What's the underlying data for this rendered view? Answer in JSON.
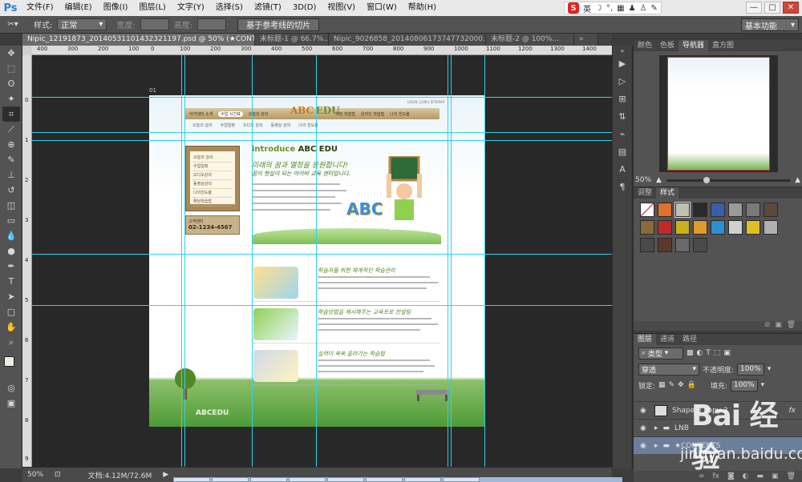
{
  "menu": {
    "logo": "Ps",
    "items": [
      "文件(F)",
      "编辑(E)",
      "图像(I)",
      "图层(L)",
      "文字(Y)",
      "选择(S)",
      "滤镜(T)",
      "3D(D)",
      "视图(V)",
      "窗口(W)",
      "帮助(H)"
    ],
    "ime_brand": "S",
    "ime_lang": "英",
    "window_controls": [
      "—",
      "□",
      "✕"
    ]
  },
  "options": {
    "style_label": "样式:",
    "style_value": "正常",
    "width_label": "宽度:",
    "height_label": "高度:",
    "slice_button": "基于参考线的切片",
    "workspace": "基本功能"
  },
  "tabs": [
    {
      "label": "Nipic_12191873_20140531101432321197.psd @ 50% (★CONTENTS, RGB/8) *",
      "active": true
    },
    {
      "label": "未标题-1 @ 66.7%...",
      "active": false
    },
    {
      "label": "Nipic_9026858_20140806173747732000.psd",
      "active": false
    },
    {
      "label": "未标题-2 @ 100%...",
      "active": false
    }
  ],
  "rulers": {
    "top_ticks": [
      "400",
      "300",
      "200",
      "100",
      "0",
      "100",
      "200",
      "300",
      "400",
      "500",
      "600",
      "700",
      "800",
      "900",
      "1000",
      "1100",
      "1200",
      "1300",
      "1400"
    ],
    "left_ticks": [
      "0",
      "1",
      "2",
      "3",
      "4",
      "5",
      "6",
      "7",
      "8",
      "9"
    ]
  },
  "document": {
    "slice_label": "01",
    "site": {
      "top_links": "LOGIN | JOIN | SITEMAP",
      "nav": [
        "아카데미 소개",
        "수업 시간표",
        "오늘의 강의",
        "해당 학습법",
        "온라인 학습법",
        "나의 진도율"
      ],
      "nav_active": "수업 시간표",
      "logo_a": "ABC",
      "logo_b": "EDU",
      "subnav": [
        "오늘의 강의",
        "수업일정",
        "오디오 강의",
        "동영상 강의",
        "나의 진도율"
      ],
      "lnb_items": [
        "오늘의 강의",
        "수업일정",
        "오디오강의",
        "동영상강의",
        "나의진도율",
        "해당학습법"
      ],
      "phone_label": "고객센터",
      "phone": "02-1234-4567",
      "intro_a": "introduce ",
      "intro_b": "ABC EDU",
      "slogan1": "미래의 꿈과 열정을 응원합니다!",
      "slogan2": "꿈이 현실이 되는 아이비 교육 센터입니다.",
      "letters": "ABC",
      "sections": [
        "학습자들 위한 체계적인 학습관리",
        "학습방법을 제시해주는 교육프로 컨설팅",
        "실력이 쑥쑥 올라가는 학습법"
      ],
      "footer_logo": "ABCEDU"
    }
  },
  "right_strip_icons": [
    "play-icon",
    "history-icon",
    "actions-icon",
    "adjust-icon",
    "brush-icon",
    "paragraph-icon",
    "character-icon"
  ],
  "panels": {
    "navigator": {
      "tabs": [
        "颜色",
        "色板",
        "导航器",
        "直方图"
      ],
      "active": "导航器",
      "zoom": "50%"
    },
    "styles": {
      "tabs": [
        "调整",
        "样式"
      ],
      "active": "样式",
      "swatches": [
        "#ffffff",
        "#e0702a",
        "#c0c0b0",
        "#2a2a2a",
        "#3a5fa8",
        "#9a9a9a",
        "#7a7a7a",
        "#5a4a3a",
        "#8a6a3a",
        "#c02a2a",
        "#c8b020",
        "#e09a2a",
        "#2a90d0",
        "#d0d0d0",
        "#e0c020",
        "#b0b0b0",
        "#4a4a4a",
        "#5a3a2a",
        "#6a6a6a",
        "#4a4a4a"
      ]
    },
    "layers": {
      "tabs": [
        "图层",
        "通道",
        "路径"
      ],
      "active": "图层",
      "filter_label": "类型",
      "blend": "穿透",
      "opacity_label": "不透明度:",
      "opacity": "100%",
      "lock_label": "锁定:",
      "fill_label": "填充:",
      "fill": "100%",
      "items": [
        {
          "name": "Shape 3 copy 2",
          "fx": "fx",
          "selected": false
        },
        {
          "name": "LNB",
          "fx": "",
          "selected": false
        },
        {
          "name": "★CONTENTS",
          "fx": "",
          "selected": true
        }
      ]
    }
  },
  "status": {
    "zoom": "50%",
    "doc_info": "文档:4.12M/72.6M"
  },
  "watermark": {
    "brand": "Bai 经验",
    "url": "jingyan.baidu.com"
  }
}
